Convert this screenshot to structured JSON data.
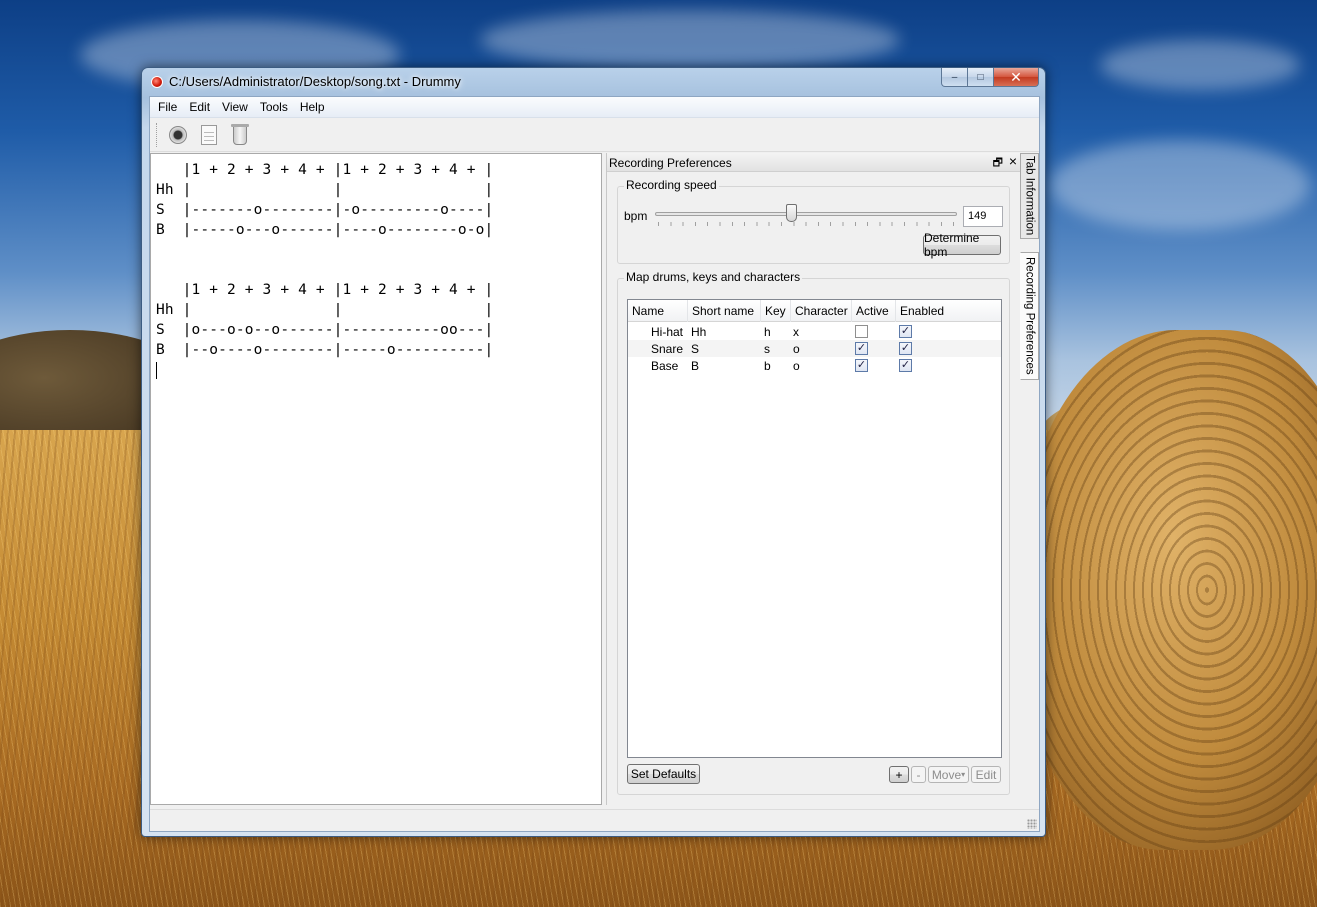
{
  "window": {
    "title": "C:/Users/Administrator/Desktop/song.txt - Drummy",
    "controls": {
      "minimize": "–",
      "maximize": "□",
      "close": "✕"
    }
  },
  "menu": [
    "File",
    "Edit",
    "View",
    "Tools",
    "Help"
  ],
  "toolbar": {
    "icons": [
      "record-icon",
      "document-icon",
      "trash-icon"
    ]
  },
  "editor": {
    "lines": [
      "   |1 + 2 + 3 + 4 + |1 + 2 + 3 + 4 + |",
      "Hh |                |                |",
      "S  |-------o--------|-o---------o----|",
      "B  |-----o---o------|----o--------o-o|",
      "",
      "",
      "   |1 + 2 + 3 + 4 + |1 + 2 + 3 + 4 + |",
      "Hh |                |                |",
      "S  |o---o-o--o------|-----------oo---|",
      "B  |--o----o--------|-----o----------|"
    ]
  },
  "dock": {
    "title": "Recording Preferences",
    "recording_speed": {
      "group_label": "Recording speed",
      "bpm_label": "bpm",
      "bpm_value": "149",
      "slider_fraction": 0.45,
      "determine_label": "Determine bpm"
    },
    "mapping": {
      "group_label": "Map drums, keys and characters",
      "columns": [
        "Name",
        "Short name",
        "Key",
        "Character",
        "Active",
        "Enabled"
      ],
      "rows": [
        {
          "name": "Hi-hat",
          "short": "Hh",
          "key": "h",
          "char": "x",
          "active": false,
          "enabled": true
        },
        {
          "name": "Snare",
          "short": "S",
          "key": "s",
          "char": "o",
          "active": true,
          "enabled": true
        },
        {
          "name": "Base",
          "short": "B",
          "key": "b",
          "char": "o",
          "active": true,
          "enabled": true
        }
      ],
      "set_defaults_label": "Set Defaults",
      "add_label": "+",
      "remove_label": "-",
      "move_label": "Move",
      "edit_label": "Edit"
    }
  },
  "side_tabs": [
    "Tab Information",
    "Recording Preferences"
  ]
}
